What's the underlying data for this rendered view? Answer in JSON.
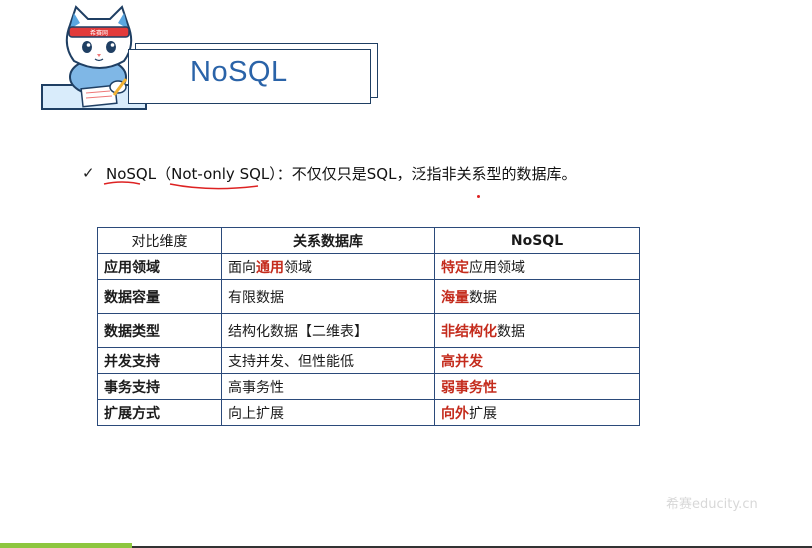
{
  "title": "NoSQL",
  "mascot": {
    "headband": "希赛网"
  },
  "bullet": {
    "check": "✓",
    "term": "NoSQL",
    "paren_open": "（",
    "paren_term": "Not-only SQL",
    "paren_close": "）",
    "rest": "：不仅仅只是SQL，泛指非关系型的数据库。"
  },
  "table": {
    "headers": [
      "对比维度",
      "关系数据库",
      "NoSQL"
    ],
    "rows": [
      {
        "dim": "应用领域",
        "rel": [
          {
            "t": "面向",
            "red": false
          },
          {
            "t": "通用",
            "red": true
          },
          {
            "t": "领域",
            "red": false
          }
        ],
        "nosql": [
          {
            "t": "特定",
            "red": true
          },
          {
            "t": "应用领域",
            "red": false
          }
        ]
      },
      {
        "dim": "数据容量",
        "rel": [
          {
            "t": "有限数据",
            "red": false
          }
        ],
        "nosql": [
          {
            "t": "海量",
            "red": true
          },
          {
            "t": "数据",
            "red": false
          }
        ]
      },
      {
        "dim": "数据类型",
        "rel": [
          {
            "t": "结构化数据【二维表】",
            "red": false
          }
        ],
        "nosql": [
          {
            "t": "非结构化",
            "red": true
          },
          {
            "t": "数据",
            "red": false
          }
        ]
      },
      {
        "dim": "并发支持",
        "rel": [
          {
            "t": "支持并发、但性能低",
            "red": false
          }
        ],
        "nosql": [
          {
            "t": "高并发",
            "red": true
          }
        ]
      },
      {
        "dim": "事务支持",
        "rel": [
          {
            "t": "高事务性",
            "red": false
          }
        ],
        "nosql": [
          {
            "t": "弱事务性",
            "red": true
          }
        ]
      },
      {
        "dim": "扩展方式",
        "rel": [
          {
            "t": "向上扩展",
            "red": false
          }
        ],
        "nosql": [
          {
            "t": "向外",
            "red": true
          },
          {
            "t": "扩展",
            "red": false
          }
        ]
      }
    ]
  },
  "watermark": "希赛educity.cn",
  "colors": {
    "title": "#2a63a8",
    "highlight": "#c42b1c",
    "border": "#2b4a7a",
    "accent_bar": "#8dc63f"
  }
}
